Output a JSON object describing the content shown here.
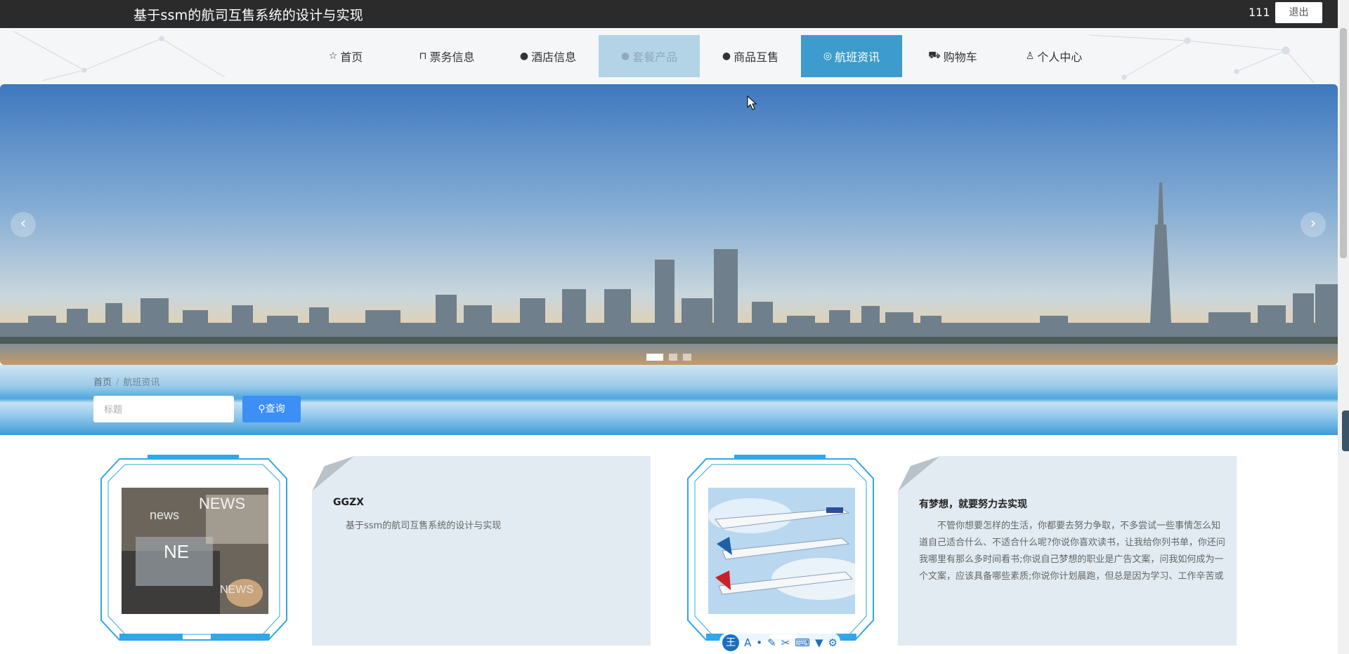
{
  "header": {
    "title": "基于ssm的航司互售系统的设计与实现",
    "username": "111",
    "logout_label": "退出"
  },
  "nav": [
    {
      "label": "首页",
      "icon": "star-icon",
      "state": "normal"
    },
    {
      "label": "票务信息",
      "icon": "bag-icon",
      "state": "normal"
    },
    {
      "label": "酒店信息",
      "icon": "exclamation-circle-icon",
      "state": "normal"
    },
    {
      "label": "套餐产品",
      "icon": "question-circle-icon",
      "state": "disabled"
    },
    {
      "label": "商品互售",
      "icon": "info-circle-icon",
      "state": "normal"
    },
    {
      "label": "航班资讯",
      "icon": "globe-icon",
      "state": "active"
    },
    {
      "label": "购物车",
      "icon": "cart-icon",
      "state": "normal"
    },
    {
      "label": "个人中心",
      "icon": "user-icon",
      "state": "normal"
    }
  ],
  "banner": {
    "prev_label": "‹",
    "next_label": "›",
    "slide_count": 3,
    "active_slide": 1
  },
  "breadcrumb": {
    "home": "首页",
    "separator": "/",
    "current": "航班资讯"
  },
  "search": {
    "placeholder": "标题",
    "value": "",
    "button_label": "查询",
    "button_icon": "search-icon"
  },
  "news": [
    {
      "title": "GGZX",
      "content": "基于ssm的航司互售系统的设计与实现",
      "image": "news-laptop-image"
    },
    {
      "title": "有梦想，就要努力去实现",
      "content": "不管你想要怎样的生活，你都要去努力争取，不多尝试一些事情怎么知道自己适合什么、不适合什么呢?你说你喜欢读书，让我给你列书单，你还问我哪里有那么多时间看书;你说自己梦想的职业是广告文案，问我如何成为一个文案，应该具备哪些素质;你说你计划晨跑，但总是因为学习、工作辛苦或者身体不舒服第二天起不了床;你说你一直梦想一个",
      "image": "airplanes-image"
    }
  ],
  "colors": {
    "topbar": "#2b2b2b",
    "nav_active": "#3d9ccd",
    "nav_disabled": "#b3d4e7",
    "search_button": "#3b8ff5",
    "card_bg": "#e1ebf1"
  },
  "ime_toolbar": {
    "icons": [
      "wang-icon",
      "font-icon",
      "dot-icon",
      "pen-icon",
      "scissors-icon",
      "keyboard-icon",
      "shirt-icon",
      "gear-icon"
    ],
    "wang_label": "王",
    "font_label": "A"
  }
}
